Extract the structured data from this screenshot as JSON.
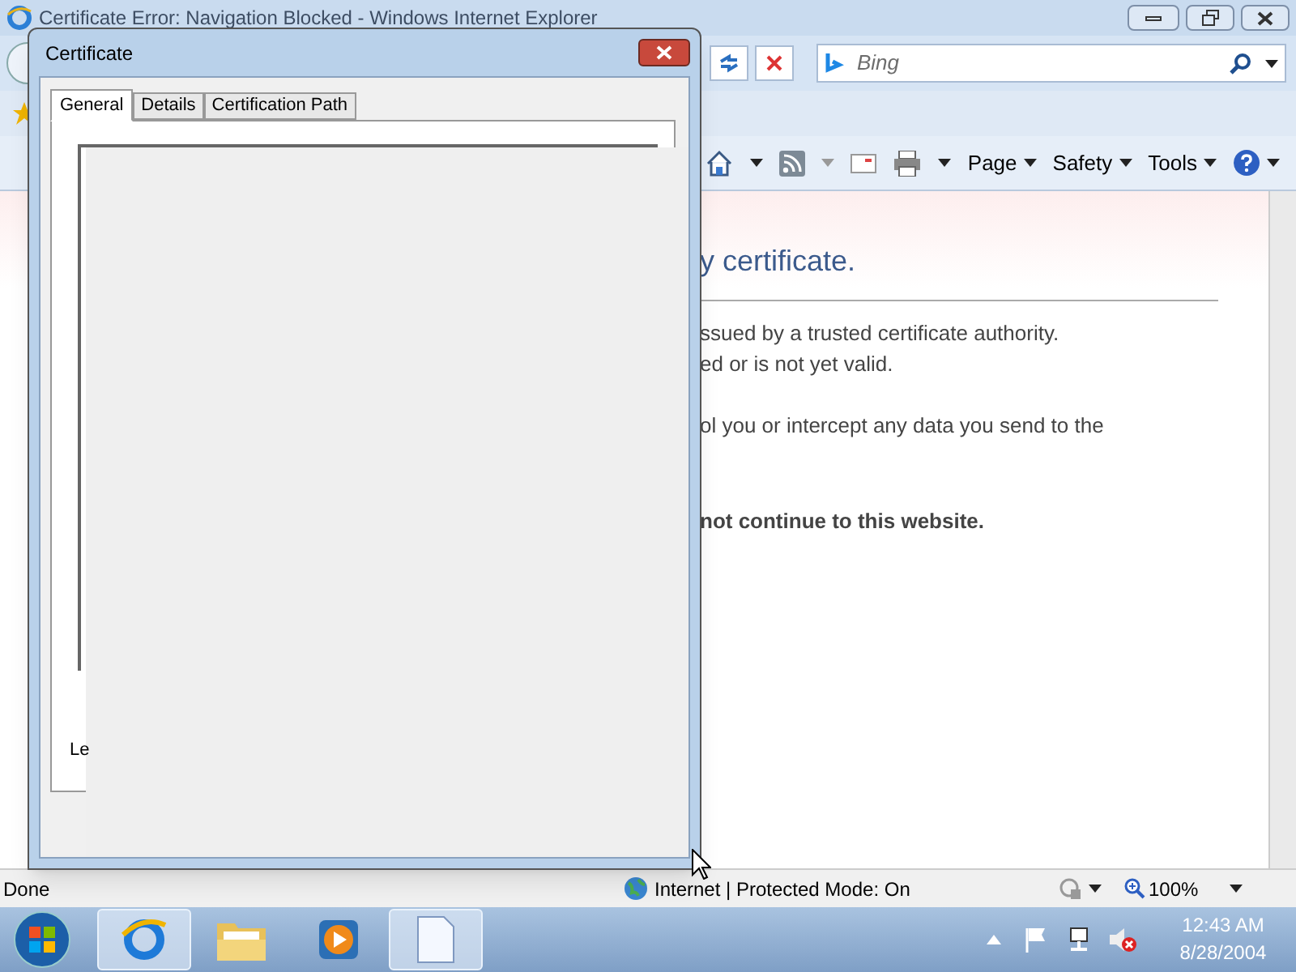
{
  "browser": {
    "title": "Certificate Error: Navigation Blocked - Windows Internet Explorer",
    "search_placeholder": "Bing",
    "command_bar": [
      {
        "label": "Page"
      },
      {
        "label": "Safety"
      },
      {
        "label": "Tools"
      }
    ]
  },
  "page": {
    "heading": "y certificate.",
    "lines": [
      "ssued by a trusted certificate authority.",
      "ed or is not yet valid.",
      "ol you or intercept any data you send to the"
    ],
    "warning": "not continue to this website."
  },
  "dialog": {
    "title": "Certificate",
    "tabs": [
      {
        "label": "General",
        "selected": true
      },
      {
        "label": "Details",
        "selected": false
      },
      {
        "label": "Certification Path",
        "selected": false
      }
    ],
    "fragment": "Le"
  },
  "status_bar": {
    "status": "Done",
    "zone": "Internet | Protected Mode: On",
    "zoom": "100%"
  },
  "taskbar": {
    "apps": [
      {
        "kind": "browser",
        "selected": true
      },
      {
        "kind": "folder",
        "selected": false
      },
      {
        "kind": "media",
        "selected": false
      },
      {
        "kind": "document",
        "selected": true
      }
    ],
    "time": "12:43 AM",
    "date": "8/28/2004"
  }
}
